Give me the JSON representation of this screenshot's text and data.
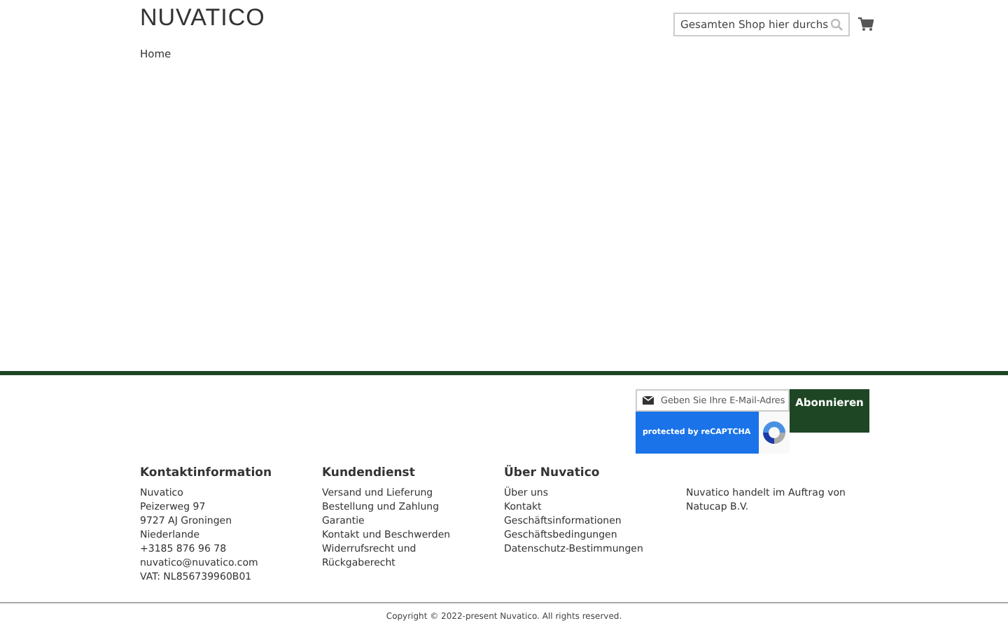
{
  "header": {
    "logo": "NUVATICO",
    "search": {
      "placeholder": "Gesamten Shop hier durchs"
    },
    "breadcrumb": "Home"
  },
  "newsletter": {
    "placeholder": "Geben Sie Ihre E-Mail-Adres",
    "button": "Abonnieren",
    "recaptcha": "protected by reCAPTCHA"
  },
  "footer": {
    "columns": [
      {
        "kind": "text",
        "title": "Kontaktinformation",
        "items": [
          "Nuvatico",
          "Peizerweg 97",
          "9727 AJ Groningen",
          "Niederlande",
          "+3185 876 96 78",
          "nuvatico@nuvatico.com",
          "VAT: NL856739960B01"
        ]
      },
      {
        "kind": "links",
        "title": "Kundendienst",
        "items": [
          "Versand und Lieferung",
          "Bestellung und Zahlung",
          "Garantie",
          "Kontakt und Beschwerden",
          "Widerrufsrecht und Rückgaberecht"
        ]
      },
      {
        "kind": "links",
        "title": "Über Nuvatico",
        "items": [
          "Über uns",
          "Kontakt",
          "Geschäftsinformationen",
          "Geschäftsbedingungen",
          "Datenschutz-Bestimmungen"
        ]
      },
      {
        "kind": "paragraph",
        "items": [
          "Nuvatico handelt im Auftrag von Natucap B.V."
        ]
      }
    ]
  },
  "copyright": "Copyright © 2022-present Nuvatico. All rights reserved."
}
